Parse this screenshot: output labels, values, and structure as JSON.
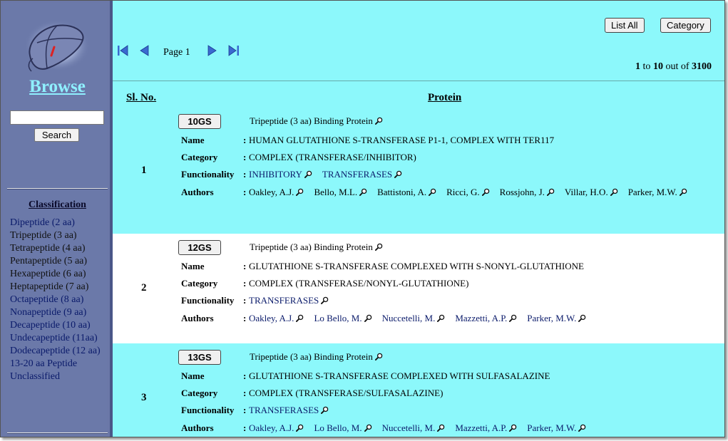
{
  "sidebar": {
    "title": "Browse",
    "search_button": "Search",
    "search_value": "",
    "classification_title": "Classification",
    "classification_items": [
      {
        "label": "Dipeptide (2 aa)",
        "dark": false
      },
      {
        "label": "Tripeptide (3 aa)",
        "dark": true
      },
      {
        "label": "Tetrapeptide (4 aa)",
        "dark": true
      },
      {
        "label": "Pentapeptide (5 aa)",
        "dark": true
      },
      {
        "label": "Hexapeptide (6 aa)",
        "dark": true
      },
      {
        "label": "Heptapeptide (7 aa)",
        "dark": true
      },
      {
        "label": "Octapeptide (8 aa)",
        "dark": false
      },
      {
        "label": "Nonapeptide (9 aa)",
        "dark": false
      },
      {
        "label": "Decapeptide (10 aa)",
        "dark": false
      },
      {
        "label": "Undecapeptide (11aa)",
        "dark": false
      },
      {
        "label": "Dodecapeptide (12 aa)",
        "dark": false
      },
      {
        "label": "13-20 aa Peptide",
        "dark": false
      },
      {
        "label": "Unclassified",
        "dark": false
      }
    ]
  },
  "toolbar": {
    "list_all": "List All",
    "category": "Category",
    "page_label": "Page 1",
    "count_from": "1",
    "count_to_word": "to",
    "count_to": "10",
    "count_outof": "out of",
    "count_total": "3100"
  },
  "table": {
    "col_slno": "Sl. No.",
    "col_protein": "Protein"
  },
  "labels": {
    "name": "Name",
    "category": "Category",
    "functionality": "Functionality",
    "authors": "Authors",
    "colon": ":"
  },
  "records": [
    {
      "num": "1",
      "pdb": "10GS",
      "type": "Tripeptide (3 aa) Binding Protein",
      "name": "HUMAN GLUTATHIONE S-TRANSFERASE P1-1, COMPLEX WITH TER117",
      "category": "COMPLEX (TRANSFERASE/INHIBITOR)",
      "functionality": [
        "INHIBITORY",
        "TRANSFERASES"
      ],
      "authors": [
        "Oakley, A.J.",
        "Bello, M.L.",
        "Battistoni, A.",
        "Ricci, G.",
        "Rossjohn, J.",
        "Villar, H.O.",
        "Parker, M.W."
      ]
    },
    {
      "num": "2",
      "pdb": "12GS",
      "type": "Tripeptide (3 aa) Binding Protein",
      "name": "GLUTATHIONE S-TRANSFERASE COMPLEXED WITH S-NONYL-GLUTATHIONE",
      "category": "COMPLEX (TRANSFERASE/NONYL-GLUTATHIONE)",
      "functionality": [
        "TRANSFERASES"
      ],
      "authors": [
        "Oakley, A.J.",
        "Lo Bello, M.",
        "Nuccetelli, M.",
        "Mazzetti, A.P.",
        "Parker, M.W."
      ]
    },
    {
      "num": "3",
      "pdb": "13GS",
      "type": "Tripeptide (3 aa) Binding Protein",
      "name": "GLUTATHIONE S-TRANSFERASE COMPLEXED WITH SULFASALAZINE",
      "category": "COMPLEX (TRANSFERASE/SULFASALAZINE)",
      "functionality": [
        "TRANSFERASES"
      ],
      "authors": [
        "Oakley, A.J.",
        "Lo Bello, M.",
        "Nuccetelli, M.",
        "Mazzetti, A.P.",
        "Parker, M.W."
      ]
    }
  ],
  "colors": {
    "main_bg": "#8cf8fb",
    "sidebar_bg": "#6b79a9",
    "title": "#8ff0ff",
    "link": "#0a1a6a"
  }
}
